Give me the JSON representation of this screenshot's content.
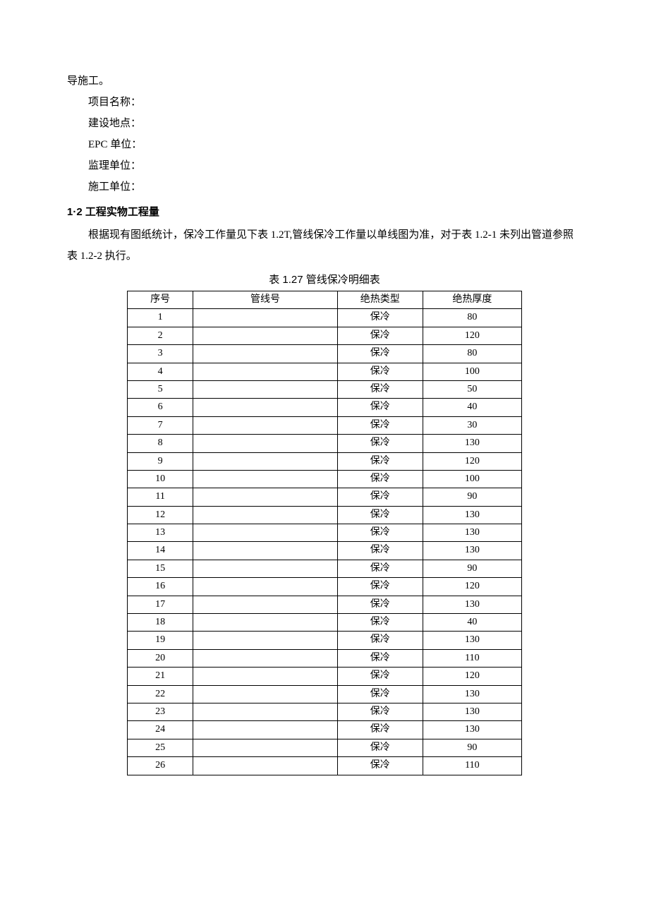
{
  "intro_tail": "导施工。",
  "info_lines": [
    "项目名称：",
    "建设地点：",
    "EPC 单位：",
    "监理单位：",
    "施工单位："
  ],
  "section_heading": "1·2 工程实物工程量",
  "body_para": "根据现有图纸统计，保冷工作量见下表 1.2T,管线保冷工作量以单线图为准，对于表 1.2-1 未列出管道参照表 1.2-2 执行。",
  "table_caption": "表 1.27 管线保冷明细表",
  "table_headers": {
    "seq": "序号",
    "line_no": "管线号",
    "ins_type": "绝热类型",
    "ins_thick": "绝热厚度"
  },
  "type_label": "保冷",
  "rows": [
    {
      "seq": "1",
      "thick": "80"
    },
    {
      "seq": "2",
      "thick": "120"
    },
    {
      "seq": "3",
      "thick": "80"
    },
    {
      "seq": "4",
      "thick": "100"
    },
    {
      "seq": "5",
      "thick": "50"
    },
    {
      "seq": "6",
      "thick": "40"
    },
    {
      "seq": "7",
      "thick": "30"
    },
    {
      "seq": "8",
      "thick": "130"
    },
    {
      "seq": "9",
      "thick": "120"
    },
    {
      "seq": "10",
      "thick": "100"
    },
    {
      "seq": "11",
      "thick": "90"
    },
    {
      "seq": "12",
      "thick": "130"
    },
    {
      "seq": "13",
      "thick": "130"
    },
    {
      "seq": "14",
      "thick": "130"
    },
    {
      "seq": "15",
      "thick": "90"
    },
    {
      "seq": "16",
      "thick": "120"
    },
    {
      "seq": "17",
      "thick": "130"
    },
    {
      "seq": "18",
      "thick": "40"
    },
    {
      "seq": "19",
      "thick": "130"
    },
    {
      "seq": "20",
      "thick": "110"
    },
    {
      "seq": "21",
      "thick": "120"
    },
    {
      "seq": "22",
      "thick": "130"
    },
    {
      "seq": "23",
      "thick": "130"
    },
    {
      "seq": "24",
      "thick": "130"
    },
    {
      "seq": "25",
      "thick": "90"
    },
    {
      "seq": "26",
      "thick": "110"
    }
  ]
}
